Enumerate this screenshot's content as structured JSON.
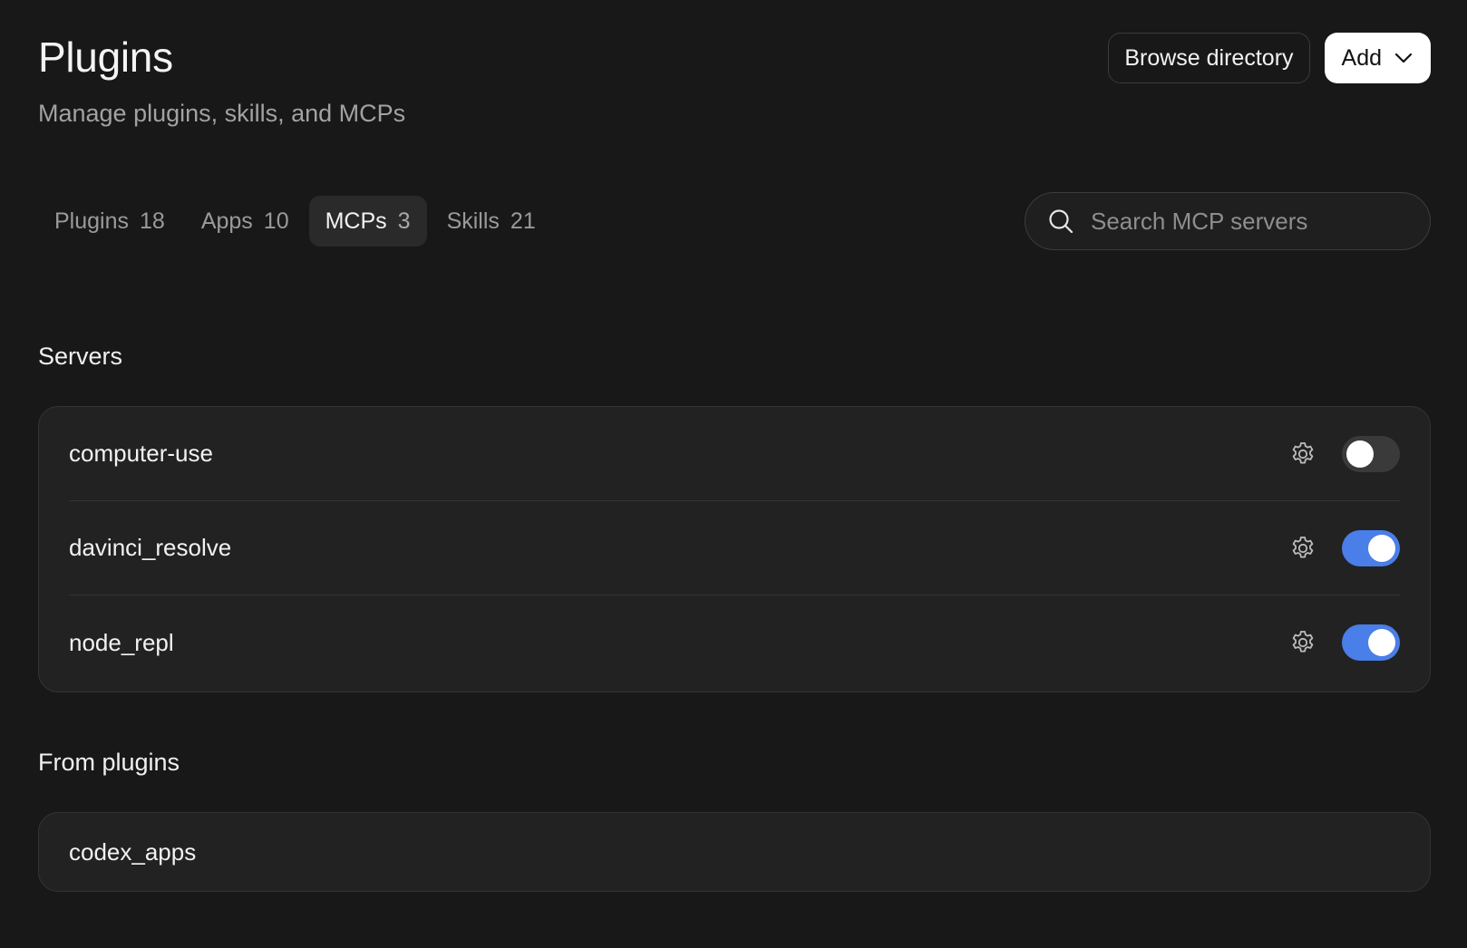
{
  "header": {
    "title": "Plugins",
    "subtitle": "Manage plugins, skills, and MCPs",
    "browse_label": "Browse directory",
    "add_label": "Add"
  },
  "tabs": [
    {
      "label": "Plugins",
      "count": "18",
      "active": false
    },
    {
      "label": "Apps",
      "count": "10",
      "active": false
    },
    {
      "label": "MCPs",
      "count": "3",
      "active": true
    },
    {
      "label": "Skills",
      "count": "21",
      "active": false
    }
  ],
  "search": {
    "placeholder": "Search MCP servers",
    "value": "",
    "icon": "search-icon"
  },
  "servers": {
    "title": "Servers",
    "items": [
      {
        "name": "computer-use",
        "enabled": false
      },
      {
        "name": "davinci_resolve",
        "enabled": true
      },
      {
        "name": "node_repl",
        "enabled": true
      }
    ]
  },
  "from_plugins": {
    "title": "From plugins",
    "items": [
      {
        "name": "codex_apps"
      }
    ]
  },
  "colors": {
    "background": "#181818",
    "card": "#222222",
    "toggle_on": "#4a7ee8",
    "toggle_off": "#3a3a3a"
  }
}
